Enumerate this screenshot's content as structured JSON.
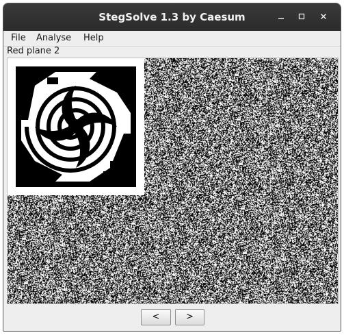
{
  "window": {
    "title": "StegSolve 1.3 by Caesum",
    "controls": [
      "minimize-icon",
      "maximize-icon",
      "close-icon"
    ]
  },
  "menu": {
    "items": [
      {
        "label": "File"
      },
      {
        "label": "Analyse"
      },
      {
        "label": "Help"
      }
    ]
  },
  "view": {
    "plane_label": "Red plane 2"
  },
  "navigation": {
    "prev_label": "<",
    "next_label": ">"
  },
  "colors": {
    "titlebar": "#2f2f2f",
    "window_bg": "#eeeeee",
    "pixel_on": "#000000",
    "pixel_off": "#ffffff"
  }
}
